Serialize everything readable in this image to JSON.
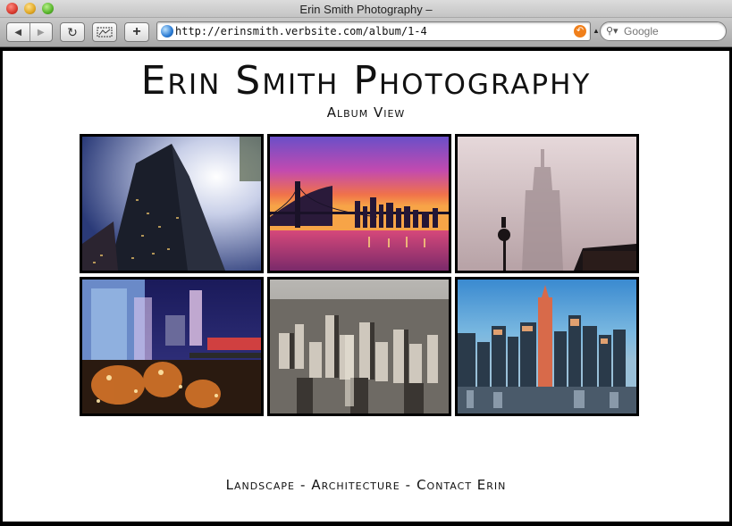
{
  "window": {
    "title": "Erin Smith Photography –"
  },
  "toolbar": {
    "back_icon": "back-arrow-icon",
    "forward_icon": "forward-arrow-icon",
    "reload_icon": "reload-icon",
    "snapshot_icon": "webclip-icon",
    "add_bookmark_label": "+"
  },
  "address": {
    "url": "http://erinsmith.verbsite.com/album/1-4"
  },
  "search": {
    "placeholder": "Google"
  },
  "site": {
    "title": "Erin Smith Photography",
    "subtitle": "Album View"
  },
  "photos": [
    {
      "name": "skyscraper-looking-up"
    },
    {
      "name": "brooklyn-bridge-sunset"
    },
    {
      "name": "empire-state-fog"
    },
    {
      "name": "city-night-lights"
    },
    {
      "name": "aerial-midtown"
    },
    {
      "name": "skyline-dusk"
    }
  ],
  "nav": {
    "landscape": "Landscape",
    "architecture": "Architecture",
    "contact": "Contact Erin",
    "separator": "-"
  }
}
